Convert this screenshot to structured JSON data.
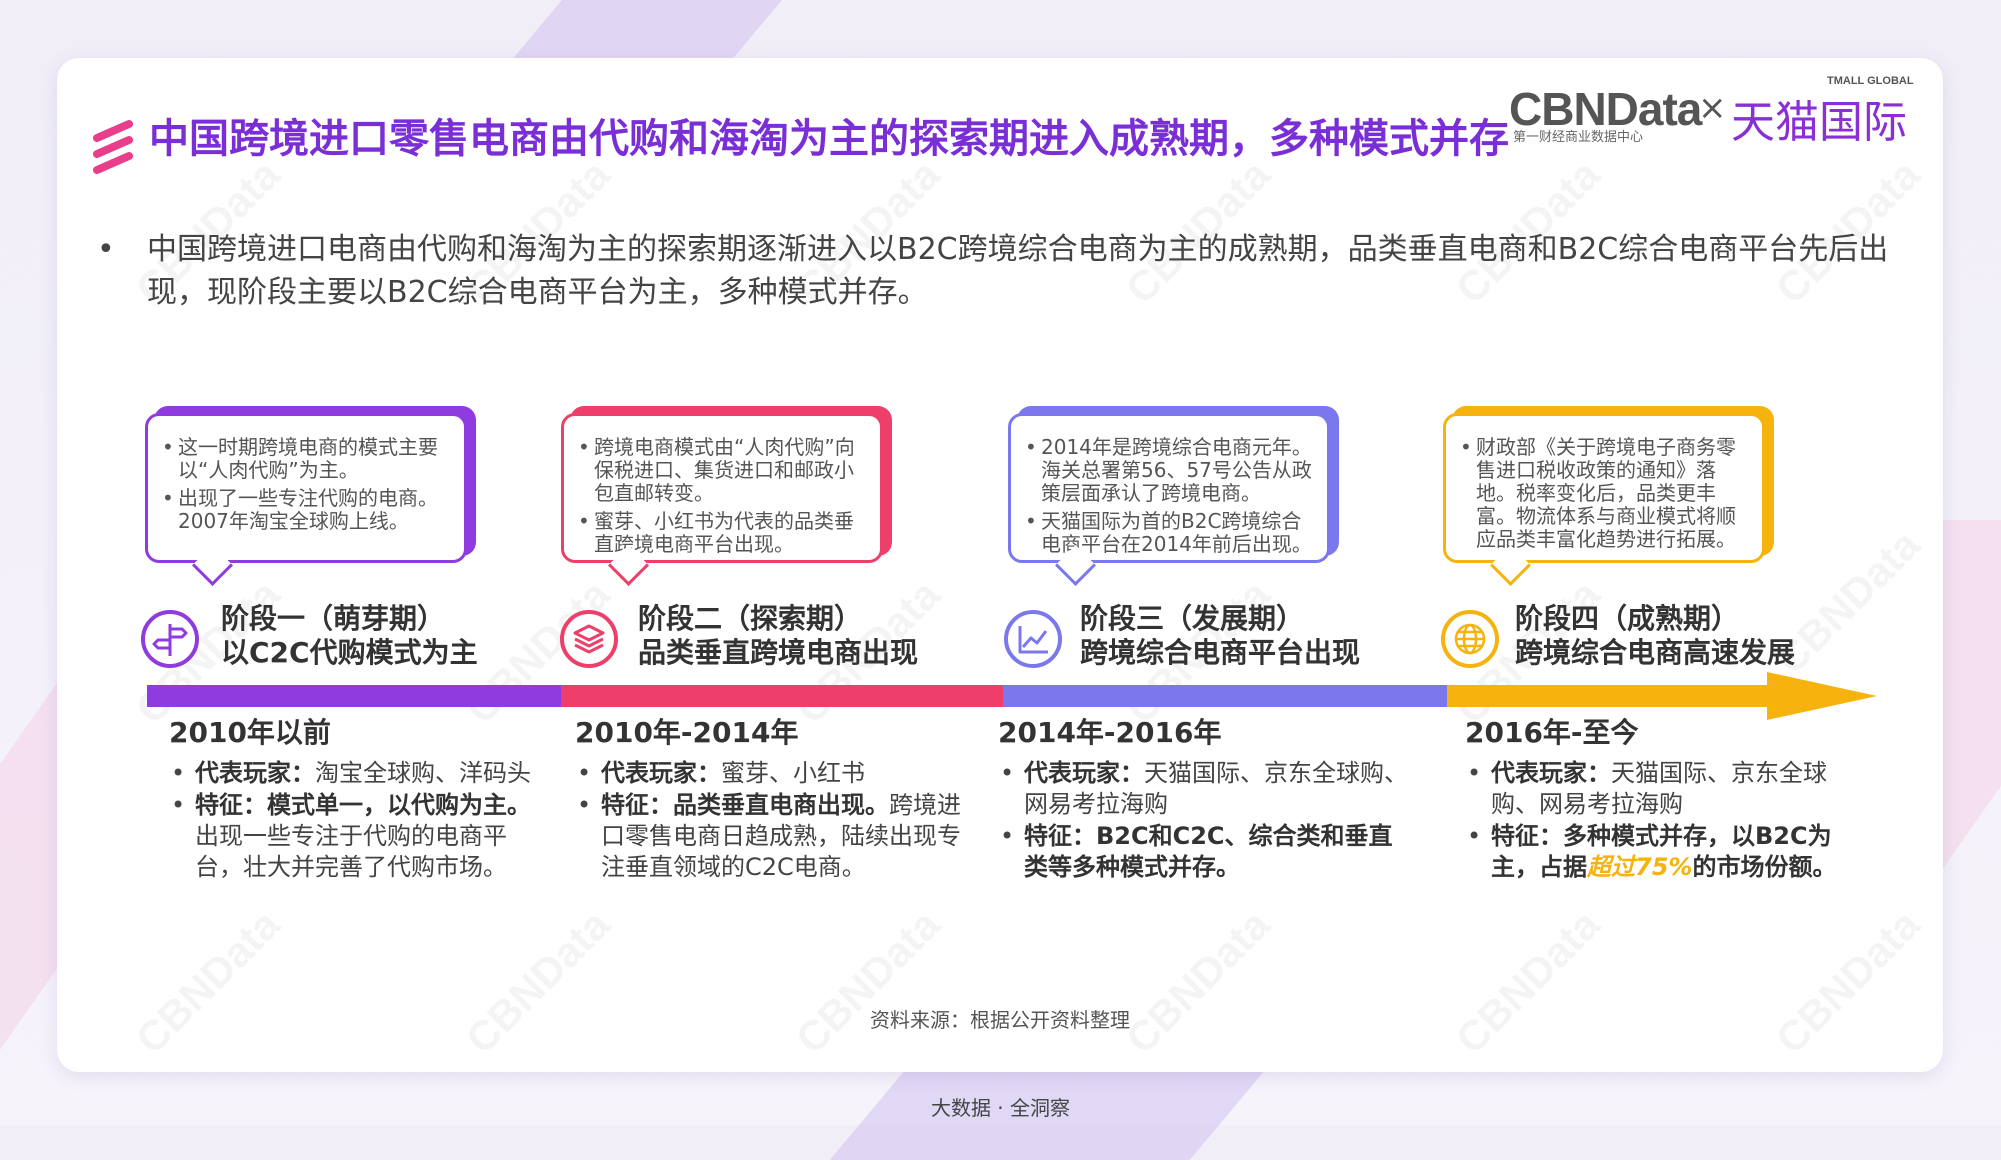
{
  "colors": {
    "purple": "#8f3be0",
    "pink": "#ee3f6b",
    "indigo": "#7b78ee",
    "gold": "#f6b30e",
    "title": "#7a2fd6"
  },
  "logos": {
    "cbn": "CBNData",
    "cbn_sub": "第一财经商业数据中心",
    "x": "×",
    "tmall": "天猫国际",
    "tmall_sub": "TMALL GLOBAL"
  },
  "watermark": "CBNData",
  "title": "中国跨境进口零售电商由代购和海淘为主的探索期进入成熟期，多种模式并存",
  "intro_bullet": "•",
  "intro": "中国跨境进口电商由代购和海淘为主的探索期逐渐进入以B2C跨境综合电商为主的成熟期，品类垂直电商和B2C综合电商平台先后出现，现阶段主要以B2C综合电商平台为主，多种模式并存。",
  "stages": [
    {
      "bubble": [
        "这一时期跨境电商的模式主要以“人肉代购”为主。",
        "出现了一些专注代购的电商。2007年淘宝全球购上线。"
      ],
      "icon": "signpost-icon",
      "name_line1": "阶段一（萌芽期）",
      "name_line2": "以C2C代购模式为主",
      "period": "2010年以前",
      "players_label": "代表玩家：",
      "players": "淘宝全球购、洋码头",
      "feature_label": "特征：",
      "feature_bold": "模式单一，以代购为主。",
      "feature_rest": "出现一些专注于代购的电商平台，壮大并完善了代购市场。"
    },
    {
      "bubble": [
        "跨境电商模式由“人肉代购”向保税进口、集货进口和邮政小包直邮转变。",
        "蜜芽、小红书为代表的品类垂直跨境电商平台出现。"
      ],
      "icon": "layers-icon",
      "name_line1": "阶段二（探索期）",
      "name_line2": "品类垂直跨境电商出现",
      "period": "2010年-2014年",
      "players_label": "代表玩家：",
      "players": "蜜芽、小红书",
      "feature_label": "特征：",
      "feature_bold": "品类垂直电商出现。",
      "feature_rest": "跨境进口零售电商日趋成熟，陆续出现专注垂直领域的C2C电商。"
    },
    {
      "bubble": [
        "2014年是跨境综合电商元年。海关总署第56、57号公告从政策层面承认了跨境电商。",
        "天猫国际为首的B2C跨境综合电商平台在2014年前后出现。"
      ],
      "icon": "trend-chart-icon",
      "name_line1": "阶段三（发展期）",
      "name_line2": "跨境综合电商平台出现",
      "period": "2014年-2016年",
      "players_label": "代表玩家：",
      "players": "天猫国际、京东全球购、网易考拉海购",
      "feature_label": "特征：",
      "feature_bold": "B2C和C2C、综合类和垂直类等多种模式并存。",
      "feature_rest": ""
    },
    {
      "bubble": [
        "财政部《关于跨境电子商务零售进口税收政策的通知》落地。税率变化后，品类更丰富。物流体系与商业模式将顺应品类丰富化趋势进行拓展。"
      ],
      "icon": "globe-icon",
      "name_line1": "阶段四（成熟期）",
      "name_line2": "跨境综合电商高速发展",
      "period": "2016年-至今",
      "players_label": "代表玩家：",
      "players": "天猫国际、京东全球购、网易考拉海购",
      "feature_label": "特征：",
      "feature_bold": "多种模式并存，以B2C为主，占据",
      "feature_highlight": "超过75%",
      "feature_tail": "的市场份额。"
    }
  ],
  "source": "资料来源：根据公开资料整理",
  "footer": "大数据 · 全洞察"
}
